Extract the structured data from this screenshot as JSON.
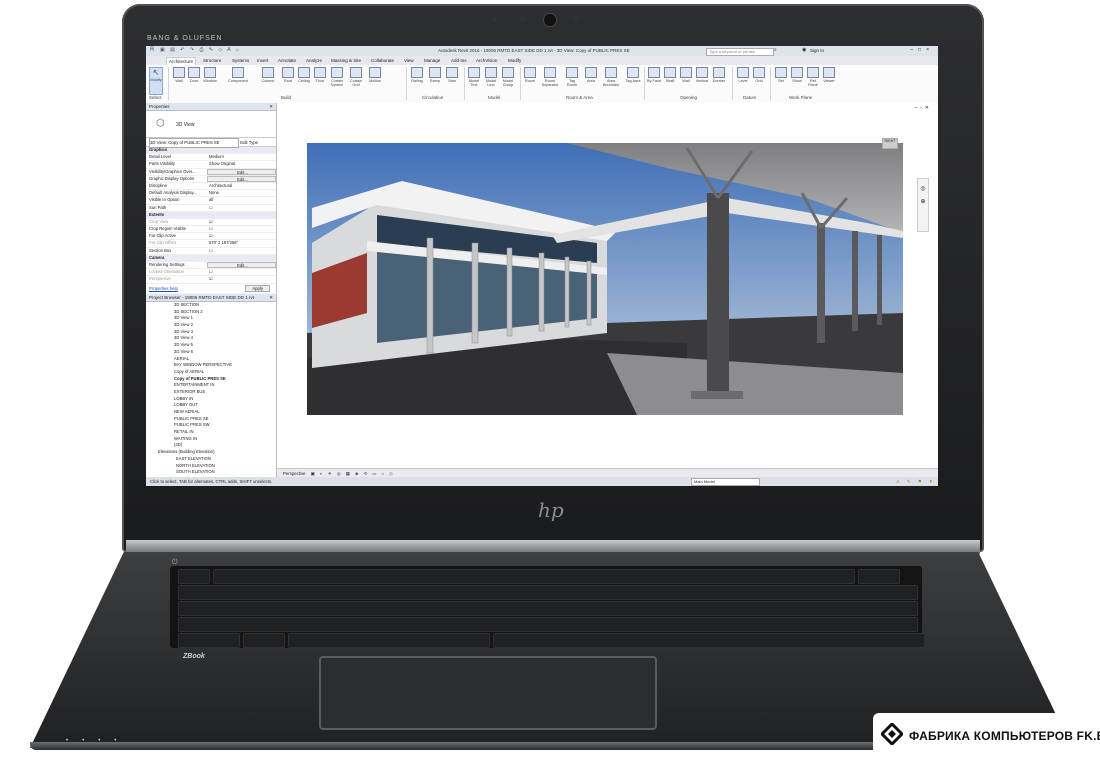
{
  "laptop": {
    "brand_audio": "BANG & OLUFSEN",
    "logo": "hp",
    "model_badge": "ZBook"
  },
  "app": {
    "title": "Autodesk Revit 2016 -  19006 RMTD EAST SIDE DD 1.rvt - 3D View: Copy of PUBLIC PRES SE",
    "search_placeholder": "Type a keyword or phrase",
    "sign_in": "Sign In",
    "tabs": [
      "Architecture",
      "Structure",
      "Systems",
      "Insert",
      "Annotate",
      "Analyze",
      "Massing & Site",
      "Collaborate",
      "View",
      "Manage",
      "Add-Ins",
      "ArchVision",
      "Modify"
    ],
    "active_tab": "Architecture"
  },
  "ribbon": {
    "modify": {
      "label": "Modify",
      "panel": "Select"
    },
    "build": {
      "tools": [
        "Wall",
        "Door",
        "Window",
        "Component",
        "Column",
        "Roof",
        "Ceiling",
        "Floor",
        "Curtain System",
        "Curtain Grid",
        "Mullion"
      ],
      "panel": "Build"
    },
    "circulation": {
      "tools": [
        "Railing",
        "Ramp",
        "Stair"
      ],
      "panel": "Circulation"
    },
    "model": {
      "tools": [
        "Model Text",
        "Model Line",
        "Model Group"
      ],
      "panel": "Model"
    },
    "room_area": {
      "tools": [
        "Room",
        "Room Separator",
        "Tag Room",
        "Area",
        "Area Boundary",
        "Tag Area"
      ],
      "panel": "Room & Area"
    },
    "opening": {
      "tools": [
        "By Face",
        "Shaft",
        "Wall",
        "Vertical",
        "Dormer"
      ],
      "panel": "Opening"
    },
    "datum": {
      "tools": [
        "Level",
        "Grid"
      ],
      "panel": "Datum"
    },
    "work_plane": {
      "tools": [
        "Set",
        "Show",
        "Ref Plane",
        "Viewer"
      ],
      "panel": "Work Plane"
    }
  },
  "properties": {
    "header": "Properties",
    "type_name": "3D View",
    "view_selector": "3D View: Copy of PUBLIC PRES SE",
    "edit_type": "Edit Type",
    "rows": [
      {
        "k": "Graphics",
        "v": "",
        "group": true
      },
      {
        "k": "Detail Level",
        "v": "Medium"
      },
      {
        "k": "Parts Visibility",
        "v": "Show Original"
      },
      {
        "k": "Visibility/Graphics Over...",
        "v": "Edit..."
      },
      {
        "k": "Graphic Display Options",
        "v": "Edit..."
      },
      {
        "k": "Discipline",
        "v": "Architectural"
      },
      {
        "k": "Default Analysis Display...",
        "v": "None"
      },
      {
        "k": "Visible In Option",
        "v": "all"
      },
      {
        "k": "Sun Path",
        "v": "☐"
      },
      {
        "k": "Extents",
        "v": "",
        "group": true
      },
      {
        "k": "Crop View",
        "v": "☑",
        "muted": true
      },
      {
        "k": "Crop Region Visible",
        "v": "☐"
      },
      {
        "k": "Far Clip Active",
        "v": "☑"
      },
      {
        "k": "Far Clip Offset",
        "v": "570'  2 187/256\"",
        "muted": true
      },
      {
        "k": "Section Box",
        "v": "☐"
      },
      {
        "k": "Camera",
        "v": "",
        "group": true
      },
      {
        "k": "Rendering Settings",
        "v": "Edit..."
      },
      {
        "k": "Locked Orientation",
        "v": "☐",
        "muted": true
      },
      {
        "k": "Perspective",
        "v": "☑",
        "muted": true
      }
    ],
    "help": "Properties help",
    "apply": "Apply"
  },
  "browser": {
    "header": "Project Browser - 19006 RMTD EAST SIDE DD 1.rvt",
    "items": [
      {
        "t": "3D SECTION"
      },
      {
        "t": "3D SECTION 2"
      },
      {
        "t": "3D View 1"
      },
      {
        "t": "3D View 2"
      },
      {
        "t": "3D View 3"
      },
      {
        "t": "3D View 4"
      },
      {
        "t": "3D View 5"
      },
      {
        "t": "3D View 6"
      },
      {
        "t": "AERIAL"
      },
      {
        "t": "BAY WINDOW PERSPECTIVE"
      },
      {
        "t": "Copy of AERIAL"
      },
      {
        "t": "Copy of PUBLIC PRES SE",
        "sel": true
      },
      {
        "t": "ENTERTAINMENT IN"
      },
      {
        "t": "EXTERIOR BUS"
      },
      {
        "t": "LOBBY IN"
      },
      {
        "t": "LOBBY OUT"
      },
      {
        "t": "NEW AERIAL"
      },
      {
        "t": "PUBLIC PRES SE"
      },
      {
        "t": "PUBLIC PRES SW"
      },
      {
        "t": "RETAIL IN"
      },
      {
        "t": "WAITING IN"
      },
      {
        "t": "{3D}"
      },
      {
        "t": "Elevations (Building Elevation)",
        "node": true
      },
      {
        "t": "EAST ELEVATION",
        "sub": true
      },
      {
        "t": "NORTH ELEVATION",
        "sub": true
      },
      {
        "t": "SOUTH ELEVATION",
        "sub": true
      }
    ]
  },
  "view": {
    "controls_label": "Perspective",
    "viewcube_label": "RIGHT"
  },
  "status": {
    "message": "Click to select, TAB for alternates, CTRL adds, SHIFT unselects.",
    "model": "Main Model"
  },
  "watermark": {
    "text": "ФАБРИКА КОМПЬЮТЕРОВ FK.BY"
  },
  "colors": {
    "sky_top": "#3f6fb7",
    "sky_bottom": "#c7d3e1",
    "canopy": "#8c8c8c",
    "brick": "#9a3a31",
    "asphalt": "#3a3a3c"
  }
}
